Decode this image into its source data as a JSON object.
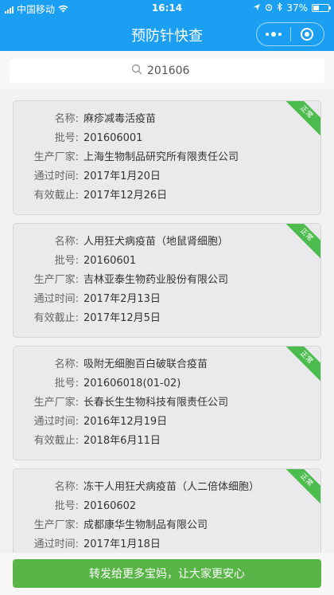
{
  "status": {
    "carrier": "中国移动",
    "time": "16:14",
    "battery": "37%",
    "battery_level": 0.37
  },
  "nav": {
    "title": "预防针快查"
  },
  "search": {
    "value": "201606"
  },
  "labels": {
    "name": "名称:",
    "batch": "批号:",
    "maker": "生产厂家:",
    "passed": "通过时间:",
    "expiry": "有效截止:"
  },
  "cards": [
    {
      "name": "麻疹减毒活疫苗",
      "batch": "201606001",
      "maker": "上海生物制品研究所有限责任公司",
      "passed": "2017年1月20日",
      "expiry": "2017年12月26日",
      "status": "正常"
    },
    {
      "name": "人用狂犬病疫苗（地鼠肾细胞）",
      "batch": "20160601",
      "maker": "吉林亚泰生物药业股份有限公司",
      "passed": "2017年2月13日",
      "expiry": "2017年12月5日",
      "status": "正常"
    },
    {
      "name": "吸附无细胞百白破联合疫苗",
      "batch": "201606018(01-02)",
      "maker": "长春长生生物科技有限责任公司",
      "passed": "2016年12月19日",
      "expiry": "2018年6月11日",
      "status": "正常"
    },
    {
      "name": "冻干人用狂犬病疫苗（人二倍体细胞）",
      "batch": "20160602",
      "maker": "成都康华生物制品有限公司",
      "passed": "2017年1月18日",
      "expiry": "",
      "status": "正常"
    }
  ],
  "share": {
    "label": "转发给更多宝妈，让大家更安心"
  }
}
